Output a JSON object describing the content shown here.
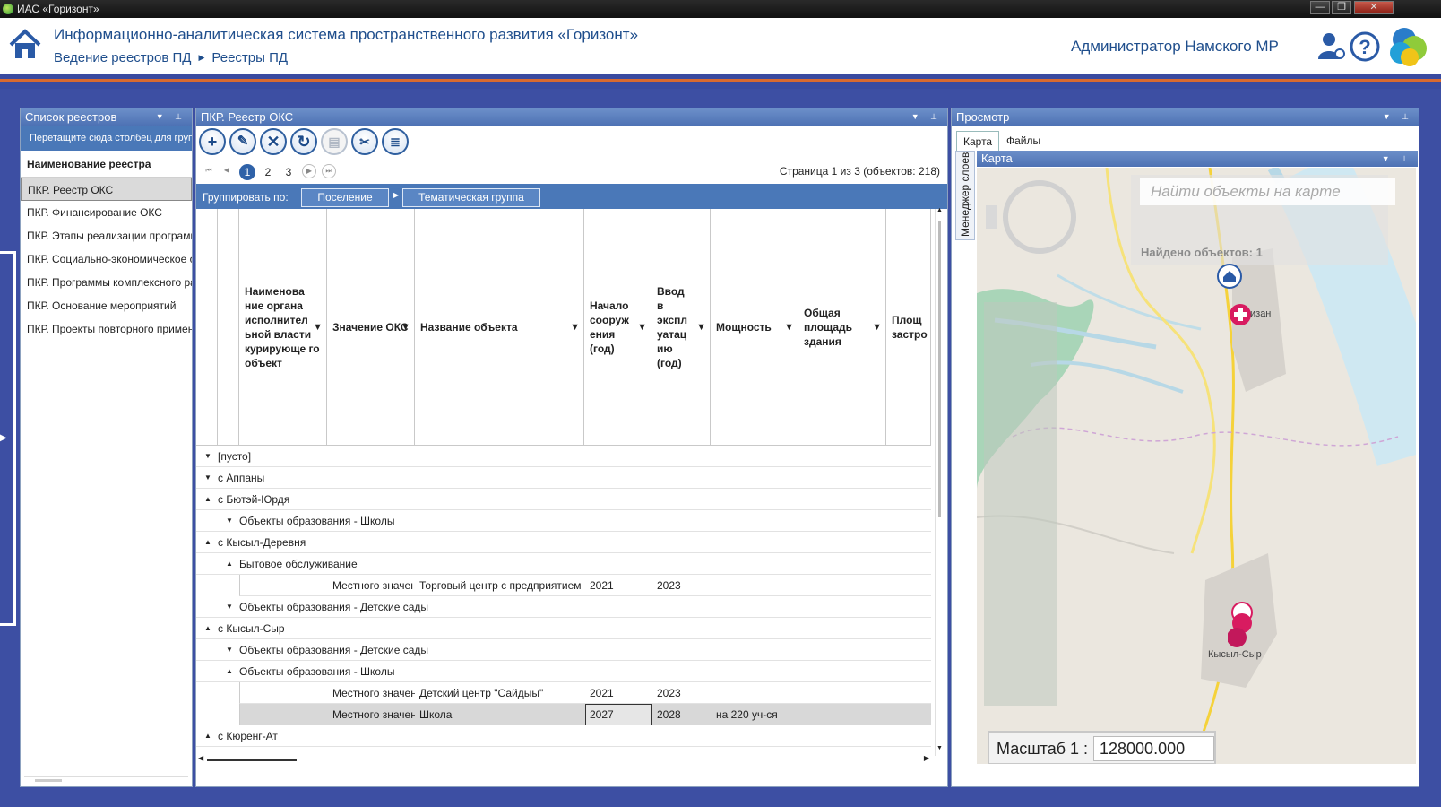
{
  "window": {
    "title": "ИАС «Горизонт»",
    "min": "—",
    "max": "❐",
    "close": "✕"
  },
  "header": {
    "title": "Информационно-аналитическая система пространственного развития «Горизонт»",
    "crumb1": "Ведение реестров ПД",
    "crumb2": "Реестры ПД",
    "user": "Администратор Намского МР"
  },
  "left_panel": {
    "title": "Список реестров",
    "hint": "Перетащите сюда столбец для группировки",
    "column": "Наименование реестра",
    "items": [
      "ПКР. Реестр ОКС",
      "ПКР. Финансирование ОКС",
      "ПКР. Этапы реализации программ",
      "ПКР. Социально-экономическое обоснование",
      "ПКР. Программы комплексного развития",
      "ПКР. Основание мероприятий",
      "ПКР. Проекты повторного применения"
    ]
  },
  "main_panel": {
    "title": "ПКР. Реестр ОКС",
    "pager": {
      "pages": [
        "1",
        "2",
        "3"
      ],
      "info": "Страница   1    из 3 (объектов: 218)"
    },
    "group": {
      "label": "Группировать по:",
      "chip1": "Поселение",
      "chip2": "Тематическая группа"
    },
    "columns": [
      "Наименование органа исполнительной власти курирующего объект",
      "Значение ОКС",
      "Название объекта",
      "Начало сооружения (год)",
      "Ввод в эксплуатацию (год)",
      "Мощность",
      "Общая площадь здания",
      "Площадь застройки"
    ],
    "columns_display": [
      "Наименова ние органа исполнител ьной власти курирующе го объект",
      "Значение ОКС",
      "Название объекта",
      "Начало сооруж ения (год)",
      "Ввод в экспл уатац ию (год)",
      "Мощность",
      "Общая площадь здания",
      "Площ застро"
    ],
    "rows": [
      {
        "level": 0,
        "text": "[пусто]",
        "toggle": "▼"
      },
      {
        "level": 0,
        "text": "с Аппаны",
        "toggle": "▼"
      },
      {
        "level": 0,
        "text": "с Бютэй-Юрдя",
        "toggle": "▲"
      },
      {
        "level": 1,
        "text": "Объекты образования - Школы",
        "toggle": "▼"
      },
      {
        "level": 0,
        "text": "с Кысыл-Деревня",
        "toggle": "▲"
      },
      {
        "level": 1,
        "text": "Бытовое обслуживание",
        "toggle": "▲"
      },
      {
        "level": 2,
        "cells": [
          "Местного значения",
          "Торговый центр с предприятием",
          "2021",
          "2023",
          ""
        ]
      },
      {
        "level": 1,
        "text": "Объекты образования - Детские сады",
        "toggle": "▼"
      },
      {
        "level": 0,
        "text": "с Кысыл-Сыр",
        "toggle": "▲"
      },
      {
        "level": 1,
        "text": "Объекты образования - Детские сады",
        "toggle": "▼"
      },
      {
        "level": 1,
        "text": "Объекты образования - Школы",
        "toggle": "▲"
      },
      {
        "level": 2,
        "cells": [
          "Местного значения",
          "Детский центр \"Сайдыы\"",
          "2021",
          "2023",
          ""
        ]
      },
      {
        "level": 2,
        "selected": true,
        "cells": [
          "Местного значения",
          "Школа",
          "2027",
          "2028",
          "на 220 уч-ся"
        ]
      },
      {
        "level": 0,
        "text": "с Кюренг-Ат",
        "toggle": "▲"
      }
    ]
  },
  "right_panel": {
    "title": "Просмотр",
    "tabs": [
      "Карта",
      "Файлы"
    ],
    "layer_manager": "Менеджер слоев",
    "map_title": "Карта",
    "search_placeholder": "Найти объекты на карте",
    "found": "Найдено объектов: 1",
    "scale_label": "Масштаб 1 :",
    "scale_value": "128000.000",
    "labels": {
      "place1": "изан",
      "place2": "Кысыл-Сыр"
    }
  }
}
